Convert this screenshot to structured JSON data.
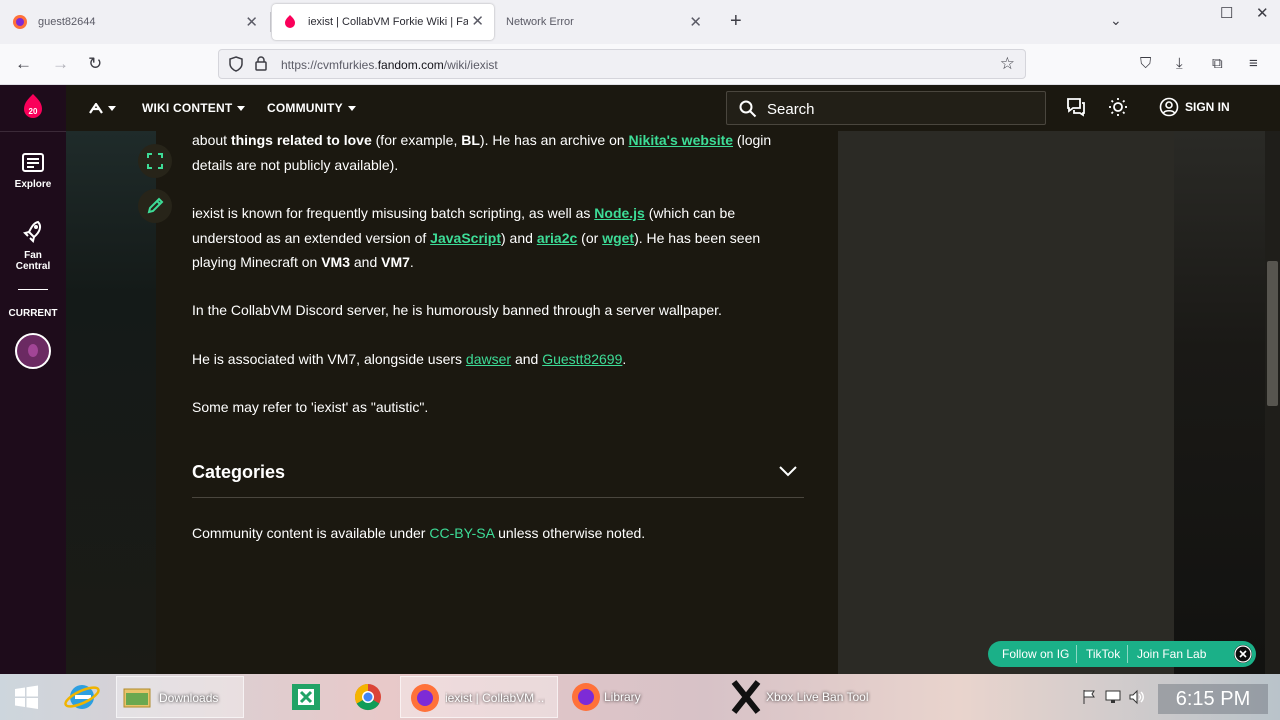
{
  "browser": {
    "tabs": [
      {
        "title": "guest82644"
      },
      {
        "title": "iexist | CollabVM Forkie Wiki | Fandom"
      },
      {
        "title": "Network Error"
      }
    ],
    "url_prefix": "https://cvmfurkies.",
    "url_domain": "fandom.com",
    "url_path": "/wiki/iexist"
  },
  "global_nav": {
    "explore_label": "Explore",
    "fan_central_label": "Fan Central",
    "current_label": "CURRENT"
  },
  "wiki_bar": {
    "menu_wiki_content": "WIKI CONTENT",
    "menu_community": "COMMUNITY",
    "search_placeholder": "Search",
    "sign_in": "SIGN IN"
  },
  "article": {
    "p1": {
      "t1": "about ",
      "b1": "things related to love",
      "t2": " (for example, ",
      "b2": "BL",
      "t3": "). He has an archive on ",
      "link1": "Nikita's website",
      "t4": " (login details are not publicly available)."
    },
    "p2": {
      "t1": "iexist is known for frequently misusing batch scripting, as well as ",
      "link1": "Node.js",
      "t2": " (which can be understood as an extended version of ",
      "link2": "JavaScript",
      "t3": ") and ",
      "link3": "aria2c",
      "t4": " (or ",
      "link4": "wget",
      "t5": "). He has been seen playing Minecraft on ",
      "b1": "VM3",
      "t6": " and ",
      "b2": "VM7",
      "t7": "."
    },
    "p3": "In the CollabVM Discord server, he is humorously banned through a server wallpaper.",
    "p4": {
      "t1": "He is associated with VM7, alongside users ",
      "link1": "dawser",
      "t2": " and ",
      "link2": "Guestt82699",
      "t3": "."
    },
    "p5": "Some may refer to 'iexist' as \"autistic\".",
    "categories_title": "Categories",
    "license": {
      "t1": "Community content is available under ",
      "link": "CC-BY-SA",
      "t2": " unless otherwise noted."
    }
  },
  "fan_lab": {
    "follow_ig": "Follow on IG",
    "tiktok": "TikTok",
    "join": "Join Fan Lab"
  },
  "taskbar": {
    "downloads": "Downloads",
    "firefox_window": "iexist | CollabVM ...",
    "library": "Library",
    "xbox": "Xbox Live Ban Tool",
    "clock": "6:15 PM"
  },
  "colors": {
    "accent_link": "#3ddc97",
    "fandom_red": "#fa005a",
    "fanlab_green": "#1bb088"
  }
}
